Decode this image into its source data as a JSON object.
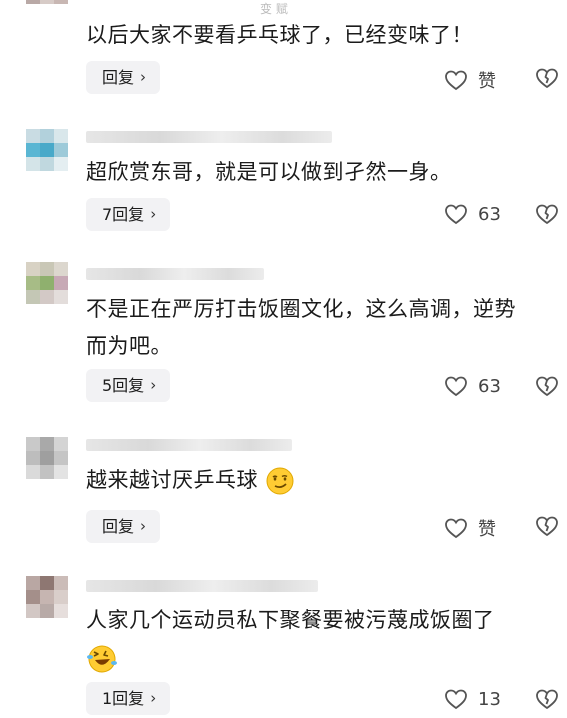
{
  "top_label": "变 赋",
  "comments": [
    {
      "text": "以后大家不要看乒乓球了，已经变味了！",
      "reply_label": "回复",
      "like_label": "赞"
    },
    {
      "text": "超欣赏东哥，就是可以做到孑然一身。",
      "reply_label": "7回复",
      "like_label": "63"
    },
    {
      "text_line1": "不是正在严厉打击饭圈文化，这么高调，逆势",
      "text_line2": "而为吧。",
      "reply_label": "5回复",
      "like_label": "63"
    },
    {
      "text": "越来越讨厌乒乓球",
      "reply_label": "回复",
      "like_label": "赞"
    },
    {
      "text": "人家几个运动员私下聚餐要被污蔑成饭圈了",
      "reply_label": "1回复",
      "like_label": "13"
    }
  ],
  "icons": {
    "like": "heart-outline-icon",
    "dislike": "broken-heart-icon",
    "reply_arrow": "chevron-right-icon",
    "emoji_1": "smirk-emoji-icon",
    "emoji_2": "laughing-crying-emoji-icon"
  },
  "colors": {
    "reply_bg": "#f2f2f4",
    "text": "#1b1b1b",
    "icon": "#555555"
  }
}
